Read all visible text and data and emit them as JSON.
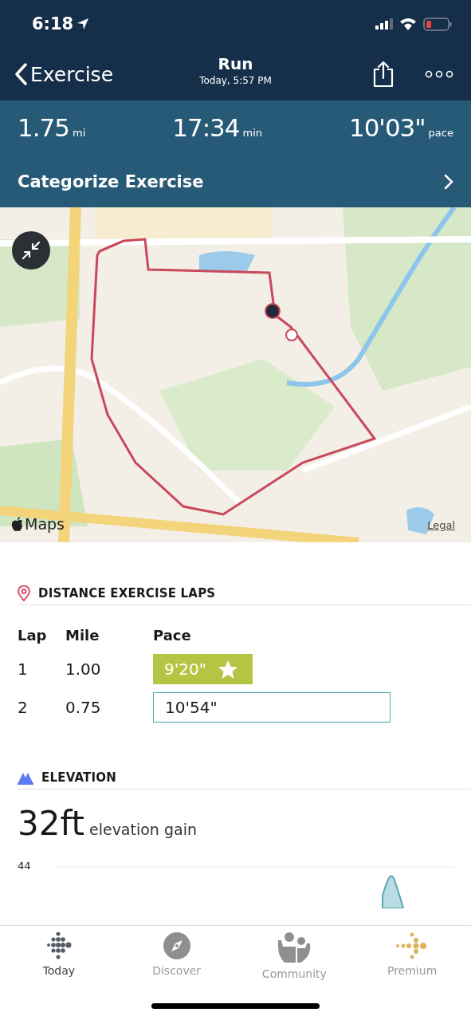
{
  "status_bar": {
    "time": "6:18"
  },
  "nav": {
    "back_label": "Exercise",
    "title": "Run",
    "subtitle": "Today, 5:57 PM"
  },
  "stats": [
    {
      "value": "1.75",
      "unit": "mi"
    },
    {
      "value": "17:34",
      "unit": "min"
    },
    {
      "value": "10'03\"",
      "unit": "pace"
    }
  ],
  "categorize": {
    "label": "Categorize Exercise"
  },
  "map": {
    "logo": "Maps",
    "legal": "Legal"
  },
  "laps": {
    "title": "DISTANCE EXERCISE LAPS",
    "columns": [
      "Lap",
      "Mile",
      "Pace"
    ],
    "rows": [
      {
        "lap": "1",
        "mile": "1.00",
        "pace": "9'20\"",
        "best": true
      },
      {
        "lap": "2",
        "mile": "0.75",
        "pace": "10'54\"",
        "best": false
      }
    ]
  },
  "elevation": {
    "title": "ELEVATION",
    "value": "32ft",
    "caption": "elevation gain",
    "axis_label": "44"
  },
  "tab_bar": [
    {
      "kind": "today",
      "label": "Today",
      "selected": true
    },
    {
      "kind": "discover",
      "label": "Discover",
      "selected": false
    },
    {
      "kind": "community",
      "label": "Community",
      "selected": false
    },
    {
      "kind": "premium",
      "label": "Premium",
      "selected": false
    }
  ]
}
